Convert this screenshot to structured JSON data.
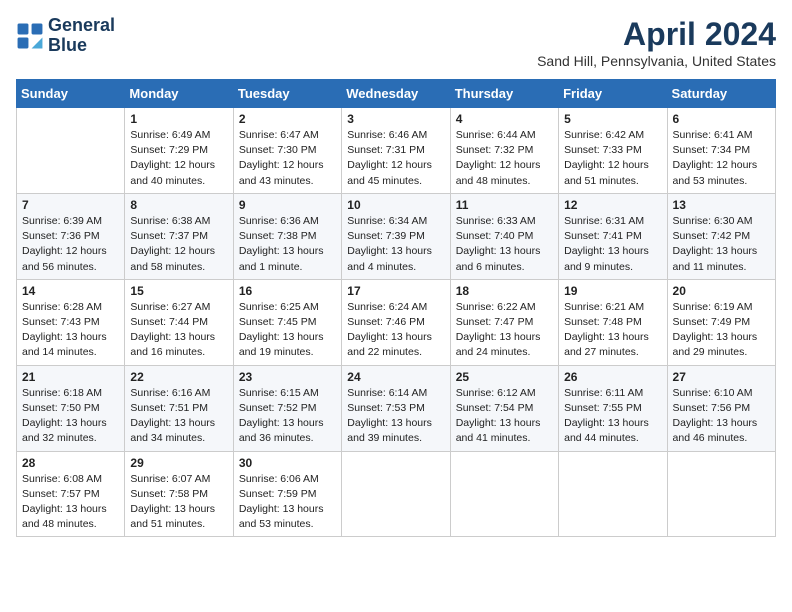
{
  "header": {
    "logo_line1": "General",
    "logo_line2": "Blue",
    "month": "April 2024",
    "location": "Sand Hill, Pennsylvania, United States"
  },
  "weekdays": [
    "Sunday",
    "Monday",
    "Tuesday",
    "Wednesday",
    "Thursday",
    "Friday",
    "Saturday"
  ],
  "weeks": [
    [
      {
        "day": "",
        "info": ""
      },
      {
        "day": "1",
        "info": "Sunrise: 6:49 AM\nSunset: 7:29 PM\nDaylight: 12 hours\nand 40 minutes."
      },
      {
        "day": "2",
        "info": "Sunrise: 6:47 AM\nSunset: 7:30 PM\nDaylight: 12 hours\nand 43 minutes."
      },
      {
        "day": "3",
        "info": "Sunrise: 6:46 AM\nSunset: 7:31 PM\nDaylight: 12 hours\nand 45 minutes."
      },
      {
        "day": "4",
        "info": "Sunrise: 6:44 AM\nSunset: 7:32 PM\nDaylight: 12 hours\nand 48 minutes."
      },
      {
        "day": "5",
        "info": "Sunrise: 6:42 AM\nSunset: 7:33 PM\nDaylight: 12 hours\nand 51 minutes."
      },
      {
        "day": "6",
        "info": "Sunrise: 6:41 AM\nSunset: 7:34 PM\nDaylight: 12 hours\nand 53 minutes."
      }
    ],
    [
      {
        "day": "7",
        "info": "Sunrise: 6:39 AM\nSunset: 7:36 PM\nDaylight: 12 hours\nand 56 minutes."
      },
      {
        "day": "8",
        "info": "Sunrise: 6:38 AM\nSunset: 7:37 PM\nDaylight: 12 hours\nand 58 minutes."
      },
      {
        "day": "9",
        "info": "Sunrise: 6:36 AM\nSunset: 7:38 PM\nDaylight: 13 hours\nand 1 minute."
      },
      {
        "day": "10",
        "info": "Sunrise: 6:34 AM\nSunset: 7:39 PM\nDaylight: 13 hours\nand 4 minutes."
      },
      {
        "day": "11",
        "info": "Sunrise: 6:33 AM\nSunset: 7:40 PM\nDaylight: 13 hours\nand 6 minutes."
      },
      {
        "day": "12",
        "info": "Sunrise: 6:31 AM\nSunset: 7:41 PM\nDaylight: 13 hours\nand 9 minutes."
      },
      {
        "day": "13",
        "info": "Sunrise: 6:30 AM\nSunset: 7:42 PM\nDaylight: 13 hours\nand 11 minutes."
      }
    ],
    [
      {
        "day": "14",
        "info": "Sunrise: 6:28 AM\nSunset: 7:43 PM\nDaylight: 13 hours\nand 14 minutes."
      },
      {
        "day": "15",
        "info": "Sunrise: 6:27 AM\nSunset: 7:44 PM\nDaylight: 13 hours\nand 16 minutes."
      },
      {
        "day": "16",
        "info": "Sunrise: 6:25 AM\nSunset: 7:45 PM\nDaylight: 13 hours\nand 19 minutes."
      },
      {
        "day": "17",
        "info": "Sunrise: 6:24 AM\nSunset: 7:46 PM\nDaylight: 13 hours\nand 22 minutes."
      },
      {
        "day": "18",
        "info": "Sunrise: 6:22 AM\nSunset: 7:47 PM\nDaylight: 13 hours\nand 24 minutes."
      },
      {
        "day": "19",
        "info": "Sunrise: 6:21 AM\nSunset: 7:48 PM\nDaylight: 13 hours\nand 27 minutes."
      },
      {
        "day": "20",
        "info": "Sunrise: 6:19 AM\nSunset: 7:49 PM\nDaylight: 13 hours\nand 29 minutes."
      }
    ],
    [
      {
        "day": "21",
        "info": "Sunrise: 6:18 AM\nSunset: 7:50 PM\nDaylight: 13 hours\nand 32 minutes."
      },
      {
        "day": "22",
        "info": "Sunrise: 6:16 AM\nSunset: 7:51 PM\nDaylight: 13 hours\nand 34 minutes."
      },
      {
        "day": "23",
        "info": "Sunrise: 6:15 AM\nSunset: 7:52 PM\nDaylight: 13 hours\nand 36 minutes."
      },
      {
        "day": "24",
        "info": "Sunrise: 6:14 AM\nSunset: 7:53 PM\nDaylight: 13 hours\nand 39 minutes."
      },
      {
        "day": "25",
        "info": "Sunrise: 6:12 AM\nSunset: 7:54 PM\nDaylight: 13 hours\nand 41 minutes."
      },
      {
        "day": "26",
        "info": "Sunrise: 6:11 AM\nSunset: 7:55 PM\nDaylight: 13 hours\nand 44 minutes."
      },
      {
        "day": "27",
        "info": "Sunrise: 6:10 AM\nSunset: 7:56 PM\nDaylight: 13 hours\nand 46 minutes."
      }
    ],
    [
      {
        "day": "28",
        "info": "Sunrise: 6:08 AM\nSunset: 7:57 PM\nDaylight: 13 hours\nand 48 minutes."
      },
      {
        "day": "29",
        "info": "Sunrise: 6:07 AM\nSunset: 7:58 PM\nDaylight: 13 hours\nand 51 minutes."
      },
      {
        "day": "30",
        "info": "Sunrise: 6:06 AM\nSunset: 7:59 PM\nDaylight: 13 hours\nand 53 minutes."
      },
      {
        "day": "",
        "info": ""
      },
      {
        "day": "",
        "info": ""
      },
      {
        "day": "",
        "info": ""
      },
      {
        "day": "",
        "info": ""
      }
    ]
  ]
}
